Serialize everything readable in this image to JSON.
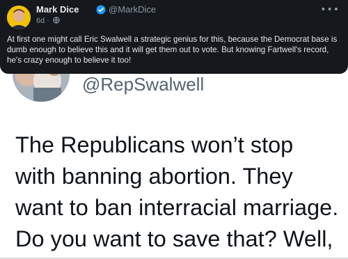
{
  "tweet": {
    "author_name": "Mark Dice",
    "handle": "@MarkDice",
    "time": "6d ·",
    "text": "At first one might call Eric Swalwell a strategic genius for this, because the Democrat base is dumb enough to believe this and it will get them out to vote. But knowing Fartwell's record, he's crazy enough to believe it too!",
    "icons": {
      "verified": "verified-badge-icon",
      "audience": "globe-icon",
      "more": "more-options-icon"
    },
    "colors": {
      "background": "#15181c",
      "text": "#e7e9ea",
      "secondary": "#8b98a5",
      "verified": "#1d9bf0"
    }
  },
  "embedded_post": {
    "handle": "@RepSwalwell",
    "lines": [
      "The Republicans won’t stop",
      "with banning abortion. They",
      "want to ban interracial marriage.",
      "Do you want to save that? Well,"
    ]
  }
}
